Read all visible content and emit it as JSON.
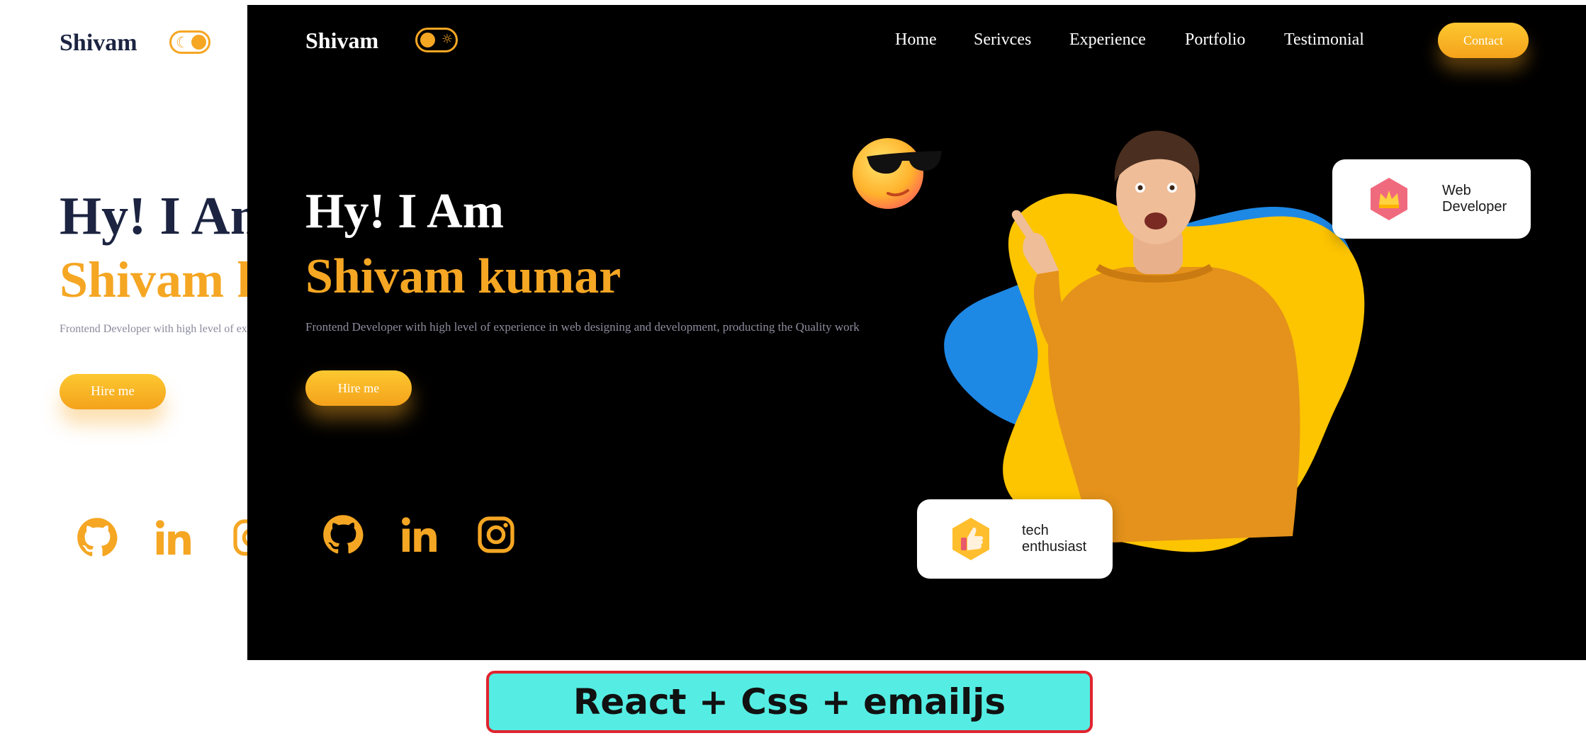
{
  "light_view": {
    "brand": "Shivam",
    "greeting": "Hy! I Am",
    "name": "Shivam kumar",
    "description": "Frontend Developer with high level of experience in web designing and development, producting the Quality work",
    "hire_label": "Hire me",
    "theme_toggle_icon": "moon-icon",
    "social_icons": [
      "github-icon",
      "linkedin-icon",
      "instagram-icon"
    ]
  },
  "dark_view": {
    "brand": "Shivam",
    "nav": [
      "Home",
      "Serivces",
      "Experience",
      "Portfolio",
      "Testimonial"
    ],
    "contact_label": "Contact",
    "greeting": "Hy! I Am",
    "name": "Shivam kumar",
    "description": "Frontend Developer with high level of experience in web designing and development, producting the Quality work",
    "hire_label": "Hire me",
    "theme_toggle_icon": "sun-icon",
    "social_icons": [
      "github-icon",
      "linkedin-icon",
      "instagram-icon"
    ],
    "badges": {
      "web": {
        "line1": "Web",
        "line2": "Developer",
        "icon": "crown-icon"
      },
      "tech": {
        "line1": "tech",
        "line2": "enthusiast",
        "icon": "thumbs-up-icon"
      }
    }
  },
  "caption": "React + Css + emailjs",
  "colors": {
    "accent": "#f5a623",
    "dark_bg": "#000000",
    "light_text": "#1c2441",
    "blob_yellow": "#fdc400",
    "blob_blue": "#1e88e5",
    "caption_bg": "#55ede3",
    "caption_border": "#e0242e"
  }
}
